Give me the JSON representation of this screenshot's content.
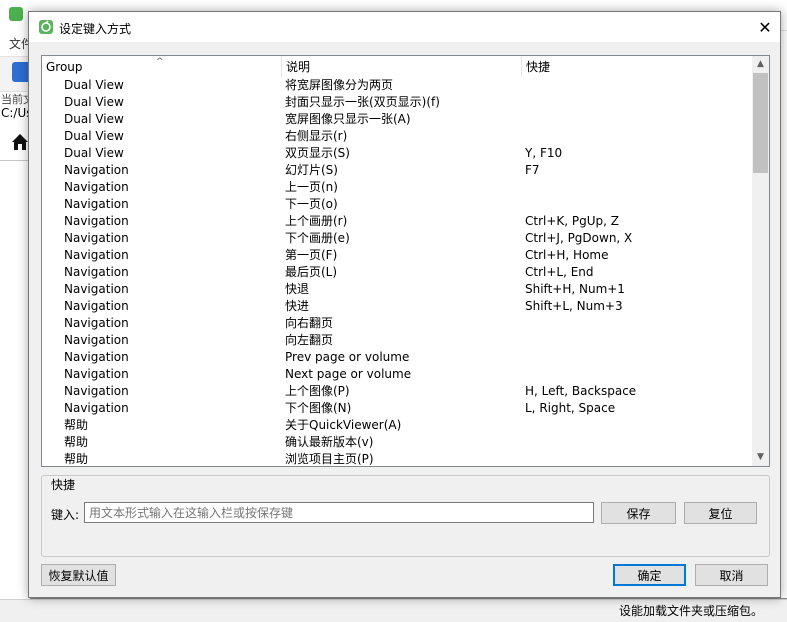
{
  "background_window": {
    "menu_file": "文件",
    "path_label": "当前文",
    "path_value": "C:/Us",
    "status_text": "设能加载文件夹或压缩包。"
  },
  "dialog": {
    "title": "设定键入方式",
    "close_glyph": "✕",
    "columns": {
      "group": "Group",
      "description": "说明",
      "shortcut": "快捷"
    },
    "rows": [
      {
        "group": "Dual View",
        "description": "将宽屏图像分为两页",
        "shortcut": ""
      },
      {
        "group": "Dual View",
        "description": "封面只显示一张(双页显示)(f)",
        "shortcut": ""
      },
      {
        "group": "Dual View",
        "description": "宽屏图像只显示一张(A)",
        "shortcut": ""
      },
      {
        "group": "Dual View",
        "description": "右侧显示(r)",
        "shortcut": ""
      },
      {
        "group": "Dual View",
        "description": "双页显示(S)",
        "shortcut": "Y, F10"
      },
      {
        "group": "Navigation",
        "description": "幻灯片(S)",
        "shortcut": "F7"
      },
      {
        "group": "Navigation",
        "description": "上一页(n)",
        "shortcut": ""
      },
      {
        "group": "Navigation",
        "description": "下一页(o)",
        "shortcut": ""
      },
      {
        "group": "Navigation",
        "description": "上个画册(r)",
        "shortcut": "Ctrl+K, PgUp, Z"
      },
      {
        "group": "Navigation",
        "description": "下个画册(e)",
        "shortcut": "Ctrl+J, PgDown, X"
      },
      {
        "group": "Navigation",
        "description": "第一页(F)",
        "shortcut": "Ctrl+H, Home"
      },
      {
        "group": "Navigation",
        "description": "最后页(L)",
        "shortcut": "Ctrl+L, End"
      },
      {
        "group": "Navigation",
        "description": "快退",
        "shortcut": "Shift+H, Num+1"
      },
      {
        "group": "Navigation",
        "description": "快进",
        "shortcut": "Shift+L, Num+3"
      },
      {
        "group": "Navigation",
        "description": "向右翻页",
        "shortcut": ""
      },
      {
        "group": "Navigation",
        "description": "向左翻页",
        "shortcut": ""
      },
      {
        "group": "Navigation",
        "description": "Prev page or volume",
        "shortcut": ""
      },
      {
        "group": "Navigation",
        "description": "Next page or volume",
        "shortcut": ""
      },
      {
        "group": "Navigation",
        "description": "上个图像(P)",
        "shortcut": "H, Left, Backspace"
      },
      {
        "group": "Navigation",
        "description": "下个图像(N)",
        "shortcut": "L, Right, Space"
      },
      {
        "group": "帮助",
        "description": "关于QuickViewer(A)",
        "shortcut": ""
      },
      {
        "group": "帮助",
        "description": "确认最新版本(v)",
        "shortcut": ""
      },
      {
        "group": "帮助",
        "description": "浏览项目主页(P)",
        "shortcut": ""
      }
    ],
    "scroll_position": 0,
    "shortcut_group": {
      "label": "快捷",
      "input_label": "键入:",
      "input_placeholder": "用文本形式输入在这输入栏或按保存键",
      "input_value": "",
      "save_button": "保存",
      "reset_button": "复位"
    },
    "buttons": {
      "restore_defaults": "恢复默认值",
      "ok": "确定",
      "cancel": "取消"
    },
    "colors": {
      "default_button_border": "#0078d7",
      "app_icon": "#5bb35f"
    }
  }
}
